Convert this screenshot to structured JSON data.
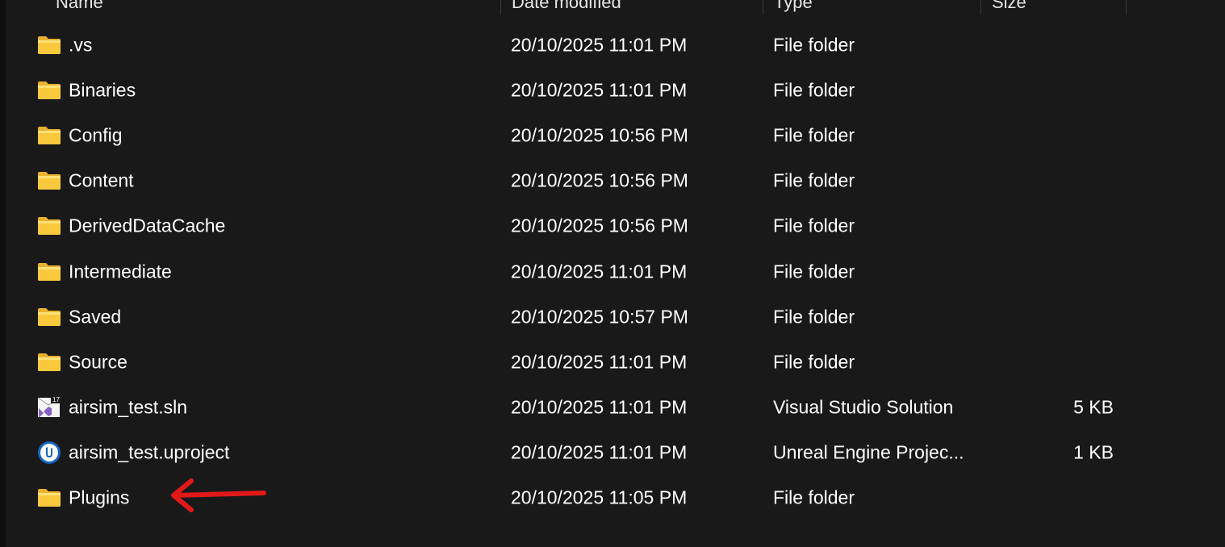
{
  "header": {
    "name": "Name",
    "date_modified": "Date modified",
    "type": "Type",
    "size": "Size"
  },
  "files": [
    {
      "name": ".vs",
      "date": "20/10/2025 11:01 PM",
      "type": "File folder",
      "size": "",
      "icon": "folder-icon"
    },
    {
      "name": "Binaries",
      "date": "20/10/2025 11:01 PM",
      "type": "File folder",
      "size": "",
      "icon": "folder-icon"
    },
    {
      "name": "Config",
      "date": "20/10/2025 10:56 PM",
      "type": "File folder",
      "size": "",
      "icon": "folder-icon"
    },
    {
      "name": "Content",
      "date": "20/10/2025 10:56 PM",
      "type": "File folder",
      "size": "",
      "icon": "folder-icon"
    },
    {
      "name": "DerivedDataCache",
      "date": "20/10/2025 10:56 PM",
      "type": "File folder",
      "size": "",
      "icon": "folder-icon"
    },
    {
      "name": "Intermediate",
      "date": "20/10/2025 11:01 PM",
      "type": "File folder",
      "size": "",
      "icon": "folder-icon"
    },
    {
      "name": "Saved",
      "date": "20/10/2025 10:57 PM",
      "type": "File folder",
      "size": "",
      "icon": "folder-icon"
    },
    {
      "name": "Source",
      "date": "20/10/2025 11:01 PM",
      "type": "File folder",
      "size": "",
      "icon": "folder-icon"
    },
    {
      "name": "airsim_test.sln",
      "date": "20/10/2025 11:01 PM",
      "type": "Visual Studio Solution",
      "size": "5 KB",
      "icon": "visual-studio-solution-icon",
      "badge": "17"
    },
    {
      "name": "airsim_test.uproject",
      "date": "20/10/2025 11:01 PM",
      "type": "Unreal Engine Projec...",
      "size": "1 KB",
      "icon": "unreal-engine-icon"
    },
    {
      "name": "Plugins",
      "date": "20/10/2025 11:05 PM",
      "type": "File folder",
      "size": "",
      "icon": "folder-icon"
    }
  ],
  "annotation": {
    "icon": "red-arrow-icon",
    "color": "#e0191b"
  },
  "colors": {
    "background": "#191919",
    "folder": "#f8c93d",
    "folder_light": "#ffe07a",
    "unreal_blue": "#1565c0",
    "vs_purple": "#8661c5"
  }
}
